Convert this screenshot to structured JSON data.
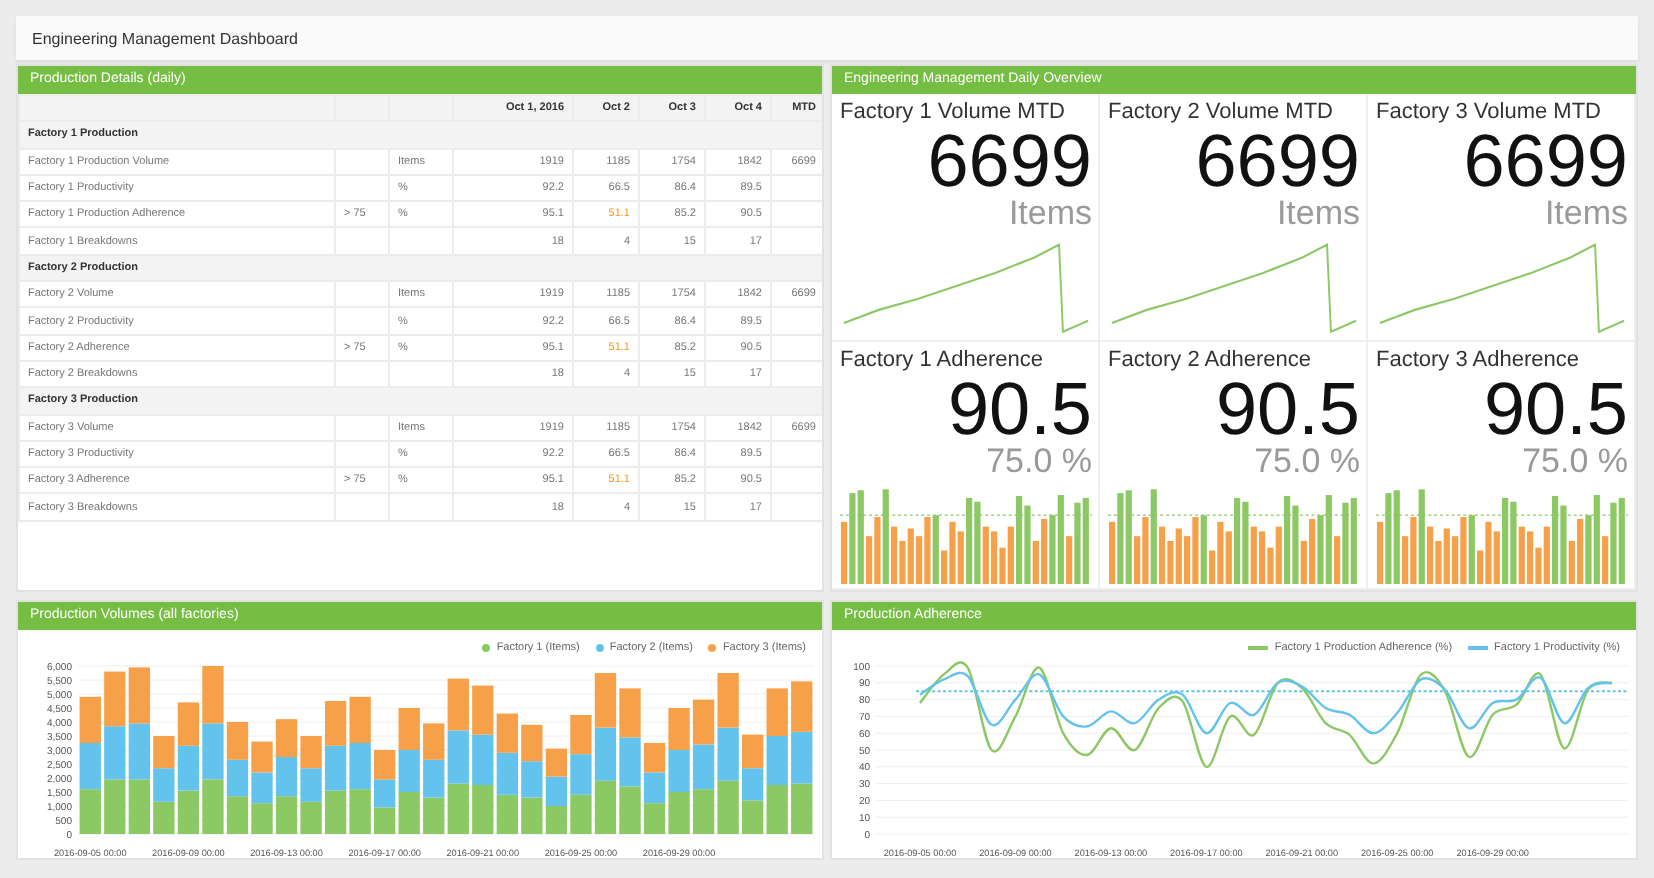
{
  "title": "Engineering Management Dashboard",
  "details": {
    "title": "Production Details (daily)",
    "columns": [
      "Oct 1, 2016",
      "Oct 2",
      "Oct 3",
      "Oct 4",
      "MTD"
    ],
    "groups": [
      {
        "title": "Factory 1 Production",
        "rows": [
          {
            "name": "Factory 1 Production Volume",
            "unit": "Items",
            "values": [
              {
                "text": "1919",
                "alert": false
              },
              {
                "text": "1185",
                "alert": false
              },
              {
                "text": "1754",
                "alert": false
              },
              {
                "text": "1842",
                "alert": false
              }
            ],
            "mtd": "6699"
          },
          {
            "name": "Factory 1 Productivity",
            "unit": "%",
            "values": [
              {
                "text": "92.2",
                "alert": false
              },
              {
                "text": "66.5",
                "alert": false
              },
              {
                "text": "86.4",
                "alert": false
              },
              {
                "text": "89.5",
                "alert": false
              }
            ]
          },
          {
            "name": "Factory 1 Production Adherence",
            "threshold": "> 75",
            "unit": "%",
            "values": [
              {
                "text": "95.1",
                "alert": false
              },
              {
                "text": "51.1",
                "alert": true
              },
              {
                "text": "85.2",
                "alert": false
              },
              {
                "text": "90.5",
                "alert": false
              }
            ]
          },
          {
            "name": "Factory 1 Breakdowns",
            "values": [
              {
                "text": "18",
                "alert": false
              },
              {
                "text": "4",
                "alert": false
              },
              {
                "text": "15",
                "alert": false
              },
              {
                "text": "17",
                "alert": false
              }
            ]
          }
        ]
      },
      {
        "title": "Factory 2 Production",
        "rows": [
          {
            "name": "Factory 2 Volume",
            "unit": "Items",
            "values": [
              {
                "text": "1919",
                "alert": false
              },
              {
                "text": "1185",
                "alert": false
              },
              {
                "text": "1754",
                "alert": false
              },
              {
                "text": "1842",
                "alert": false
              }
            ],
            "mtd": "6699"
          },
          {
            "name": "Factory 2 Productivity",
            "unit": "%",
            "values": [
              {
                "text": "92.2",
                "alert": false
              },
              {
                "text": "66.5",
                "alert": false
              },
              {
                "text": "86.4",
                "alert": false
              },
              {
                "text": "89.5",
                "alert": false
              }
            ]
          },
          {
            "name": "Factory 2 Adherence",
            "threshold": "> 75",
            "unit": "%",
            "values": [
              {
                "text": "95.1",
                "alert": false
              },
              {
                "text": "51.1",
                "alert": true
              },
              {
                "text": "85.2",
                "alert": false
              },
              {
                "text": "90.5",
                "alert": false
              }
            ]
          },
          {
            "name": "Factory 2 Breakdowns",
            "values": [
              {
                "text": "18",
                "alert": false
              },
              {
                "text": "4",
                "alert": false
              },
              {
                "text": "15",
                "alert": false
              },
              {
                "text": "17",
                "alert": false
              }
            ]
          }
        ]
      },
      {
        "title": "Factory 3 Production",
        "rows": [
          {
            "name": "Factory 3 Volume",
            "unit": "Items",
            "values": [
              {
                "text": "1919",
                "alert": false
              },
              {
                "text": "1185",
                "alert": false
              },
              {
                "text": "1754",
                "alert": false
              },
              {
                "text": "1842",
                "alert": false
              }
            ],
            "mtd": "6699"
          },
          {
            "name": "Factory 3 Productivity",
            "unit": "%",
            "values": [
              {
                "text": "92.2",
                "alert": false
              },
              {
                "text": "66.5",
                "alert": false
              },
              {
                "text": "86.4",
                "alert": false
              },
              {
                "text": "89.5",
                "alert": false
              }
            ]
          },
          {
            "name": "Factory 3 Adherence",
            "threshold": "> 75",
            "unit": "%",
            "values": [
              {
                "text": "95.1",
                "alert": false
              },
              {
                "text": "51.1",
                "alert": true
              },
              {
                "text": "85.2",
                "alert": false
              },
              {
                "text": "90.5",
                "alert": false
              }
            ]
          },
          {
            "name": "Factory 3 Breakdowns",
            "values": [
              {
                "text": "18",
                "alert": false
              },
              {
                "text": "4",
                "alert": false
              },
              {
                "text": "15",
                "alert": false
              },
              {
                "text": "17",
                "alert": false
              }
            ]
          }
        ]
      }
    ]
  },
  "overview": {
    "title": "Engineering Management Daily Overview",
    "tiles": [
      {
        "kind": "volume",
        "title": "Factory 1 Volume MTD",
        "value": "6699",
        "unit": "Items"
      },
      {
        "kind": "volume",
        "title": "Factory 2 Volume MTD",
        "value": "6699",
        "unit": "Items"
      },
      {
        "kind": "volume",
        "title": "Factory 3 Volume MTD",
        "value": "6699",
        "unit": "Items"
      },
      {
        "kind": "adherence",
        "title": "Factory 1 Adherence",
        "value": "90.5",
        "unit": "75.0 %"
      },
      {
        "kind": "adherence",
        "title": "Factory 2 Adherence",
        "value": "90.5",
        "unit": "75.0 %"
      },
      {
        "kind": "adherence",
        "title": "Factory 3 Adherence",
        "value": "90.5",
        "unit": "75.0 %"
      }
    ]
  },
  "volumes": {
    "title": "Production Volumes (all factories)",
    "chart_data": {
      "type": "bar",
      "stacked": true,
      "grid": true,
      "legend": "top right",
      "categories": [
        "2016-09-05 00:00",
        null,
        null,
        null,
        "2016-09-09 00:00",
        null,
        null,
        null,
        "2016-09-13 00:00",
        null,
        null,
        null,
        "2016-09-17 00:00",
        null,
        null,
        null,
        "2016-09-21 00:00",
        null,
        null,
        null,
        "2016-09-25 00:00",
        null,
        null,
        null,
        "2016-09-29 00:00",
        null,
        null,
        null,
        null,
        null
      ],
      "ylim": [
        0,
        6000
      ],
      "yticks": [
        {
          "value": 0,
          "label": "0"
        },
        {
          "value": 500,
          "label": "500"
        },
        {
          "value": 1000,
          "label": "1,000"
        },
        {
          "value": 1500,
          "label": "1,500"
        },
        {
          "value": 2000,
          "label": "2,000"
        },
        {
          "value": 2500,
          "label": "2,500"
        },
        {
          "value": 3000,
          "label": "3,000"
        },
        {
          "value": 3500,
          "label": "3,500"
        },
        {
          "value": 4000,
          "label": "4,000"
        },
        {
          "value": 4500,
          "label": "4,500"
        },
        {
          "value": 5000,
          "label": "5,000"
        },
        {
          "value": 5500,
          "label": "5,500"
        },
        {
          "value": 6000,
          "label": "6,000"
        }
      ],
      "series": [
        {
          "name": "Factory 1 (Items)",
          "color": "#8cc864",
          "values": [
            1600,
            1950,
            1950,
            1150,
            1550,
            1950,
            1350,
            1100,
            1350,
            1150,
            1550,
            1600,
            950,
            1500,
            1300,
            1800,
            1750,
            1400,
            1300,
            1000,
            1400,
            1900,
            1700,
            1100,
            1500,
            1600,
            1900,
            1200,
            1750,
            1800
          ]
        },
        {
          "name": "Factory 2 (Items)",
          "color": "#64c3ec",
          "values": [
            1650,
            1900,
            2000,
            1200,
            1600,
            2000,
            1300,
            1100,
            1400,
            1200,
            1600,
            1650,
            1000,
            1500,
            1350,
            1900,
            1800,
            1500,
            1300,
            1050,
            1450,
            1900,
            1750,
            1100,
            1500,
            1600,
            1900,
            1150,
            1750,
            1850
          ]
        },
        {
          "name": "Factory 3 (Items)",
          "color": "#f7a04a",
          "values": [
            1650,
            1950,
            2000,
            1150,
            1550,
            2050,
            1350,
            1100,
            1350,
            1150,
            1600,
            1650,
            1050,
            1500,
            1300,
            1850,
            1750,
            1400,
            1300,
            1000,
            1400,
            1950,
            1750,
            1050,
            1500,
            1600,
            1950,
            1200,
            1700,
            1800
          ]
        }
      ]
    }
  },
  "adherence": {
    "title": "Production Adherence",
    "chart_data": {
      "type": "line",
      "grid": true,
      "legend": "top right",
      "categories": [
        "2016-09-05 00:00",
        null,
        null,
        null,
        "2016-09-09 00:00",
        null,
        null,
        null,
        "2016-09-13 00:00",
        null,
        null,
        null,
        "2016-09-17 00:00",
        null,
        null,
        null,
        "2016-09-21 00:00",
        null,
        null,
        null,
        "2016-09-25 00:00",
        null,
        null,
        null,
        "2016-09-29 00:00",
        null,
        null,
        null,
        null,
        null
      ],
      "ylim": [
        0,
        100
      ],
      "yticks": [
        0,
        10,
        20,
        30,
        40,
        50,
        60,
        70,
        80,
        90,
        100
      ],
      "series": [
        {
          "name": "Factory 1 Production Adherence (%)",
          "color": "#8cc864",
          "values": [
            78,
            95,
            99,
            50,
            70,
            99,
            60,
            47,
            63,
            50,
            75,
            79,
            40,
            70,
            59,
            90,
            87,
            66,
            59,
            42,
            60,
            95,
            85,
            46,
            71,
            77,
            95,
            51,
            86,
            90
          ]
        },
        {
          "name": "Factory 1 Productivity (%)",
          "color": "#64c3ec",
          "values": [
            83,
            92,
            94,
            65,
            80,
            95,
            70,
            64,
            73,
            66,
            80,
            83,
            60,
            78,
            71,
            90,
            88,
            75,
            71,
            60,
            72,
            92,
            86,
            63,
            78,
            80,
            93,
            66,
            87,
            90
          ]
        }
      ],
      "ref_lines": [
        {
          "axis": "y",
          "value": 85,
          "color": "#64c3ec"
        }
      ]
    }
  }
}
